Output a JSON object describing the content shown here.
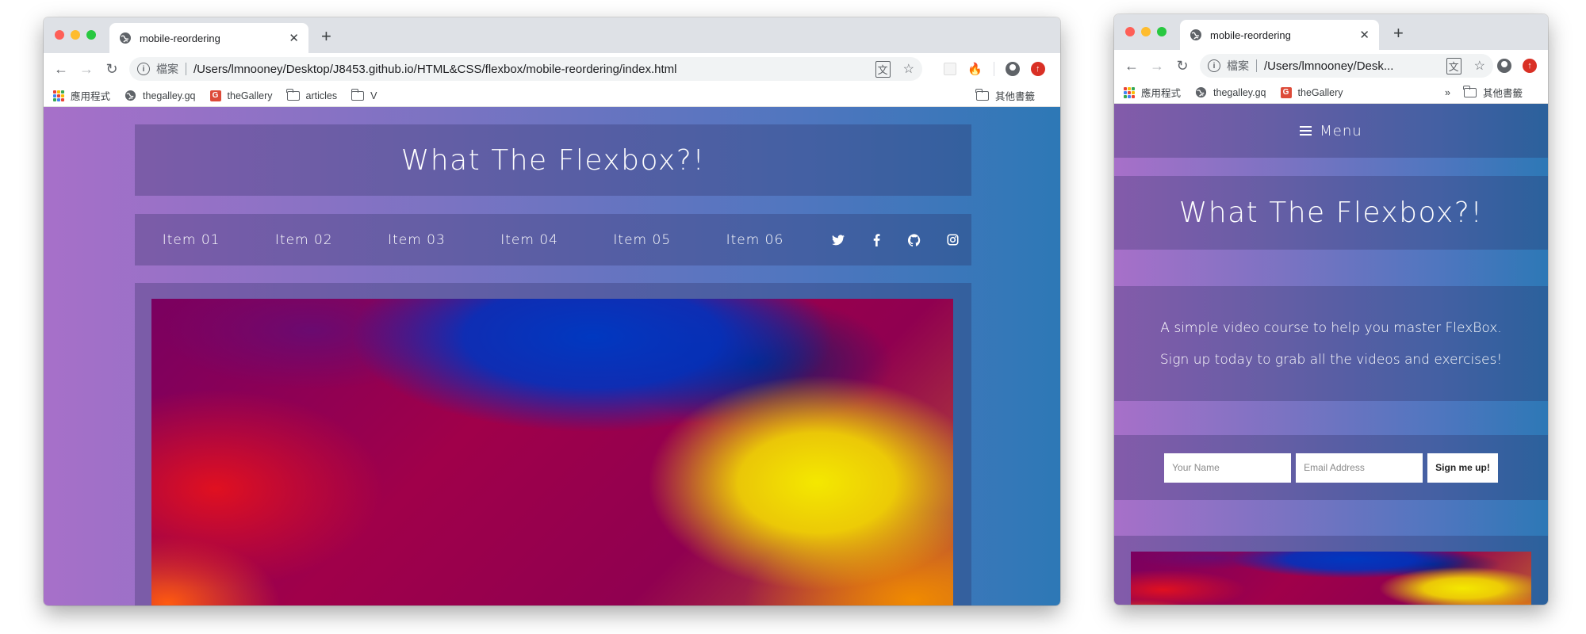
{
  "desktop": {
    "tab_title": "mobile-reordering",
    "omnibox": {
      "file_label": "檔案",
      "url": "/Users/lmnooney/Desktop/J8453.github.io/HTML&CSS/flexbox/mobile-reordering/index.html"
    },
    "bookmarks": [
      {
        "label": "應用程式",
        "icon": "apps-grid-icon"
      },
      {
        "label": "thegalley.gq",
        "icon": "globe-icon"
      },
      {
        "label": "theGallery",
        "icon": "g-logo-icon"
      },
      {
        "label": "articles",
        "icon": "folder-icon"
      },
      {
        "label": "V",
        "icon": "folder-icon"
      }
    ],
    "other_bookmarks": "其他書籤",
    "page": {
      "title": "What The Flexbox?!",
      "nav_items": [
        "Item 01",
        "Item 02",
        "Item 03",
        "Item 04",
        "Item 05",
        "Item 06"
      ],
      "social_icons": [
        "twitter-icon",
        "facebook-icon",
        "github-icon",
        "instagram-icon"
      ]
    }
  },
  "mobile": {
    "tab_title": "mobile-reordering",
    "omnibox": {
      "file_label": "檔案",
      "url": "/Users/lmnooney/Desk..."
    },
    "bookmarks": [
      {
        "label": "應用程式",
        "icon": "apps-grid-icon"
      },
      {
        "label": "thegalley.gq",
        "icon": "globe-icon"
      },
      {
        "label": "theGallery",
        "icon": "g-logo-icon"
      }
    ],
    "overflow_chevron": "»",
    "other_bookmarks": "其他書籤",
    "page": {
      "menu_label": "Menu",
      "title": "What The Flexbox?!",
      "tagline_1": "A simple video course to help you master FlexBox.",
      "tagline_2": "Sign up today to grab all the videos and exercises!",
      "name_placeholder": "Your Name",
      "email_placeholder": "Email Address",
      "signup_label": "Sign me up!"
    }
  },
  "colors": {
    "gradient_start": "#a770c9",
    "gradient_end": "#2d78b6",
    "panel_overlay": "rgba(40,40,90,0.28)",
    "chrome_frame": "#dee1e6"
  }
}
